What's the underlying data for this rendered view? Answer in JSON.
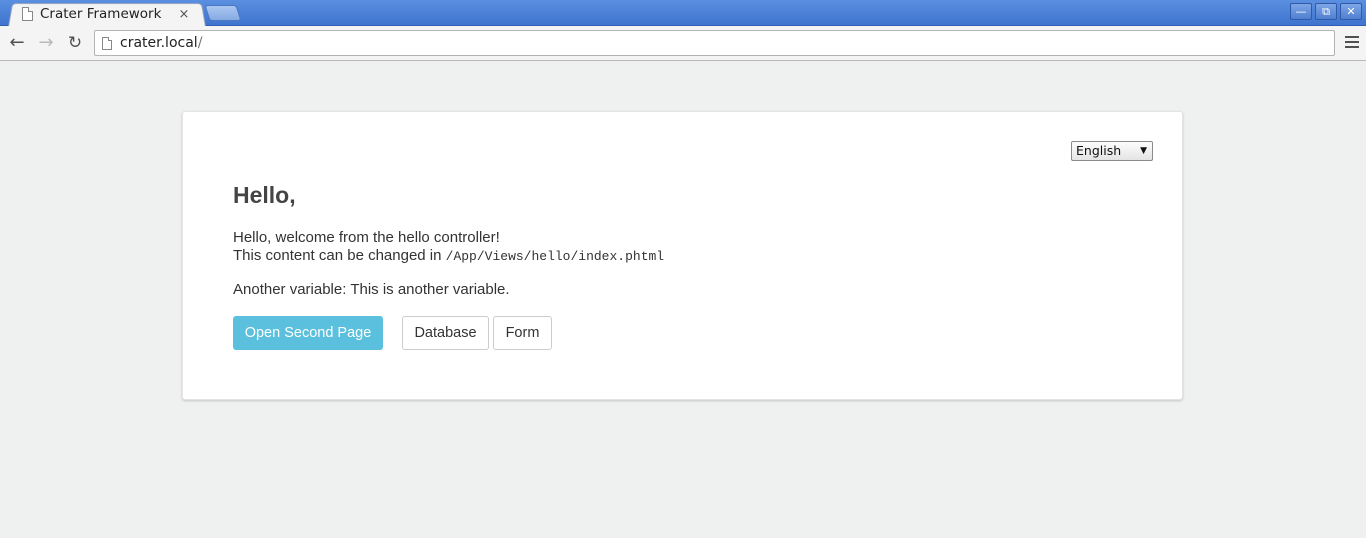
{
  "browser": {
    "tab": {
      "title": "Crater Framework",
      "close_glyph": "×"
    },
    "window_controls": {
      "minimize": "—",
      "restore": "⧉",
      "close": "✕"
    },
    "nav": {
      "back": "←",
      "forward": "→",
      "reload": "↻"
    },
    "address": {
      "host": "crater.local",
      "path": "/"
    }
  },
  "page": {
    "language_select": {
      "value": "English",
      "arrow": "▼"
    },
    "heading": "Hello,",
    "welcome_line": "Hello, welcome from the hello controller!",
    "content_prefix": "This content can be changed in",
    "content_path": "/App/Views/hello/index.phtml",
    "another_label": "Another variable:",
    "another_value": "This is another variable.",
    "buttons": {
      "open_second": "Open Second Page",
      "database": "Database",
      "form": "Form"
    }
  },
  "colors": {
    "titlebar": "#3f74cf",
    "primary_button": "#5bc0de",
    "page_background": "#eff0f0"
  }
}
